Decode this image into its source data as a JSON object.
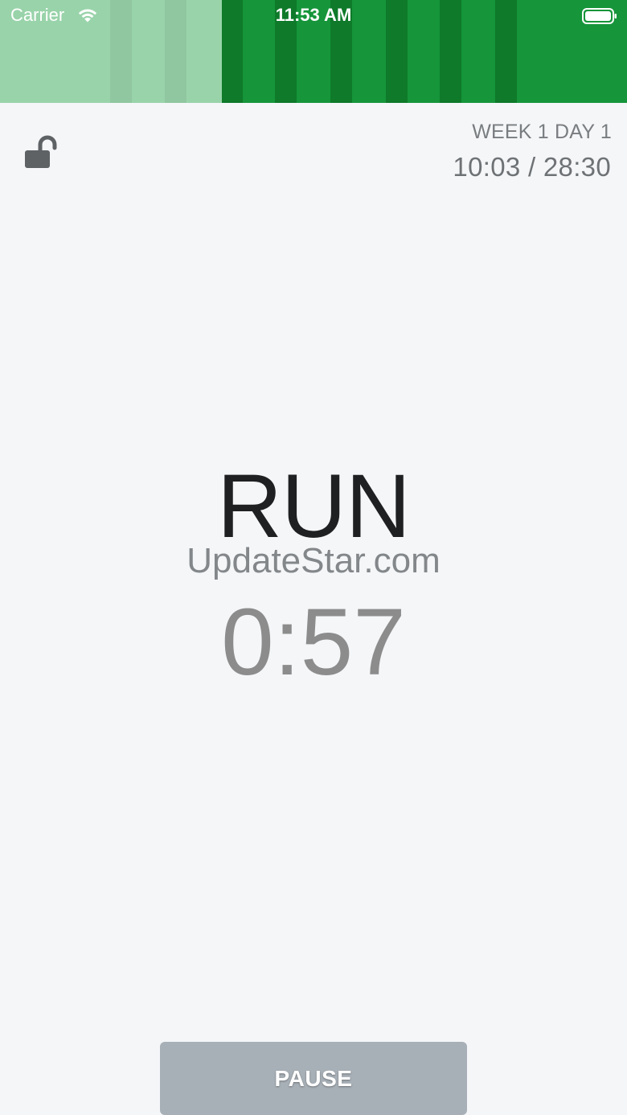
{
  "status_bar": {
    "carrier": "Carrier",
    "time": "11:53 AM"
  },
  "progress": {
    "completed_fraction": 0.354,
    "completed_color": "#99d3aa",
    "remaining_color": "#16953a",
    "accent_stripe_color": "#0e7a2a"
  },
  "header": {
    "lock_icon": "unlocked-padlock-icon",
    "week_day": "WEEK 1 DAY 1",
    "elapsed_total": "10:03 / 28:30"
  },
  "main": {
    "phase": "RUN",
    "watermark": "UpdateStar.com",
    "countdown": "0:57"
  },
  "controls": {
    "pause_label": "PAUSE",
    "pause_color": "#a8b0b7"
  }
}
